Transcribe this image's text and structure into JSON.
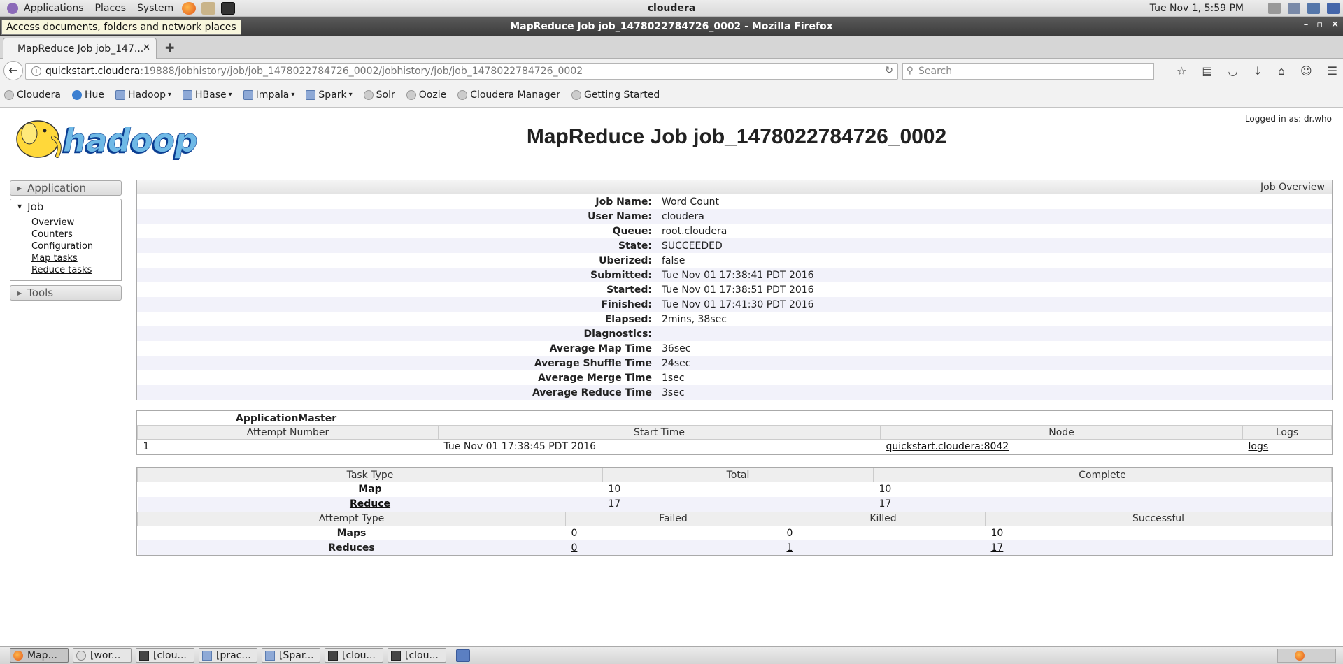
{
  "desktop": {
    "menus": [
      "Applications",
      "Places",
      "System"
    ],
    "hostname": "cloudera",
    "clock": "Tue Nov  1,  5:59 PM",
    "tooltip": "Access documents, folders and network places"
  },
  "window": {
    "title": "MapReduce Job job_1478022784726_0002 - Mozilla Firefox",
    "controls": [
      "–",
      "▫",
      "✕"
    ]
  },
  "browser": {
    "tab_label": "MapReduce Job job_147...",
    "url_host": "quickstart.cloudera",
    "url_path": ":19888/jobhistory/job/job_1478022784726_0002/jobhistory/job/job_1478022784726_0002",
    "search_placeholder": "Search",
    "bookmarks": [
      {
        "label": "Cloudera",
        "icon": "globe-icon",
        "dropdown": false
      },
      {
        "label": "Hue",
        "icon": "hue-icon",
        "dropdown": false
      },
      {
        "label": "Hadoop",
        "icon": "folder-icon",
        "dropdown": true
      },
      {
        "label": "HBase",
        "icon": "folder-icon",
        "dropdown": true
      },
      {
        "label": "Impala",
        "icon": "folder-icon",
        "dropdown": true
      },
      {
        "label": "Spark",
        "icon": "folder-icon",
        "dropdown": true
      },
      {
        "label": "Solr",
        "icon": "globe-icon",
        "dropdown": false
      },
      {
        "label": "Oozie",
        "icon": "globe-icon",
        "dropdown": false
      },
      {
        "label": "Cloudera Manager",
        "icon": "globe-icon",
        "dropdown": false
      },
      {
        "label": "Getting Started",
        "icon": "globe-icon",
        "dropdown": false
      }
    ]
  },
  "page": {
    "logged_in": "Logged in as: dr.who",
    "logo_text": "hadoop",
    "title": "MapReduce Job job_1478022784726_0002",
    "nav": {
      "application": "Application",
      "job": "Job",
      "job_links": [
        "Overview",
        "Counters",
        "Configuration",
        "Map tasks",
        "Reduce tasks"
      ],
      "tools": "Tools"
    },
    "overview": {
      "header": "Job Overview",
      "rows": [
        {
          "k": "Job Name:",
          "v": "Word Count"
        },
        {
          "k": "User Name:",
          "v": "cloudera"
        },
        {
          "k": "Queue:",
          "v": "root.cloudera"
        },
        {
          "k": "State:",
          "v": "SUCCEEDED"
        },
        {
          "k": "Uberized:",
          "v": "false"
        },
        {
          "k": "Submitted:",
          "v": "Tue Nov 01 17:38:41 PDT 2016"
        },
        {
          "k": "Started:",
          "v": "Tue Nov 01 17:38:51 PDT 2016"
        },
        {
          "k": "Finished:",
          "v": "Tue Nov 01 17:41:30 PDT 2016"
        },
        {
          "k": "Elapsed:",
          "v": "2mins, 38sec"
        },
        {
          "k": "Diagnostics:",
          "v": ""
        },
        {
          "k": "Average Map Time",
          "v": "36sec"
        },
        {
          "k": "Average Shuffle Time",
          "v": "24sec"
        },
        {
          "k": "Average Merge Time",
          "v": "1sec"
        },
        {
          "k": "Average Reduce Time",
          "v": "3sec"
        }
      ]
    },
    "am": {
      "title": "ApplicationMaster",
      "headers": [
        "Attempt Number",
        "Start Time",
        "Node",
        "Logs"
      ],
      "row": {
        "attempt": "1",
        "start": "Tue Nov 01 17:38:45 PDT 2016",
        "node": "quickstart.cloudera:8042",
        "logs": "logs"
      }
    },
    "tasks": {
      "headers": [
        "Task Type",
        "Total",
        "Complete"
      ],
      "rows": [
        {
          "type": "Map",
          "total": "10",
          "complete": "10"
        },
        {
          "type": "Reduce",
          "total": "17",
          "complete": "17"
        }
      ],
      "attempt_headers": [
        "Attempt Type",
        "Failed",
        "Killed",
        "Successful"
      ],
      "attempt_rows": [
        {
          "type": "Maps",
          "failed": "0",
          "killed": "0",
          "successful": "10"
        },
        {
          "type": "Reduces",
          "failed": "0",
          "killed": "1",
          "successful": "17"
        }
      ]
    }
  },
  "taskbar": {
    "items": [
      "Map...",
      "[wor...",
      "[clou...",
      "[prac...",
      "[Spar...",
      "[clou...",
      "[clou..."
    ]
  },
  "colors": {
    "accent": "#3c3c3c",
    "row_stripe": "#f2f2fa",
    "folder": "#8ea9d6"
  }
}
